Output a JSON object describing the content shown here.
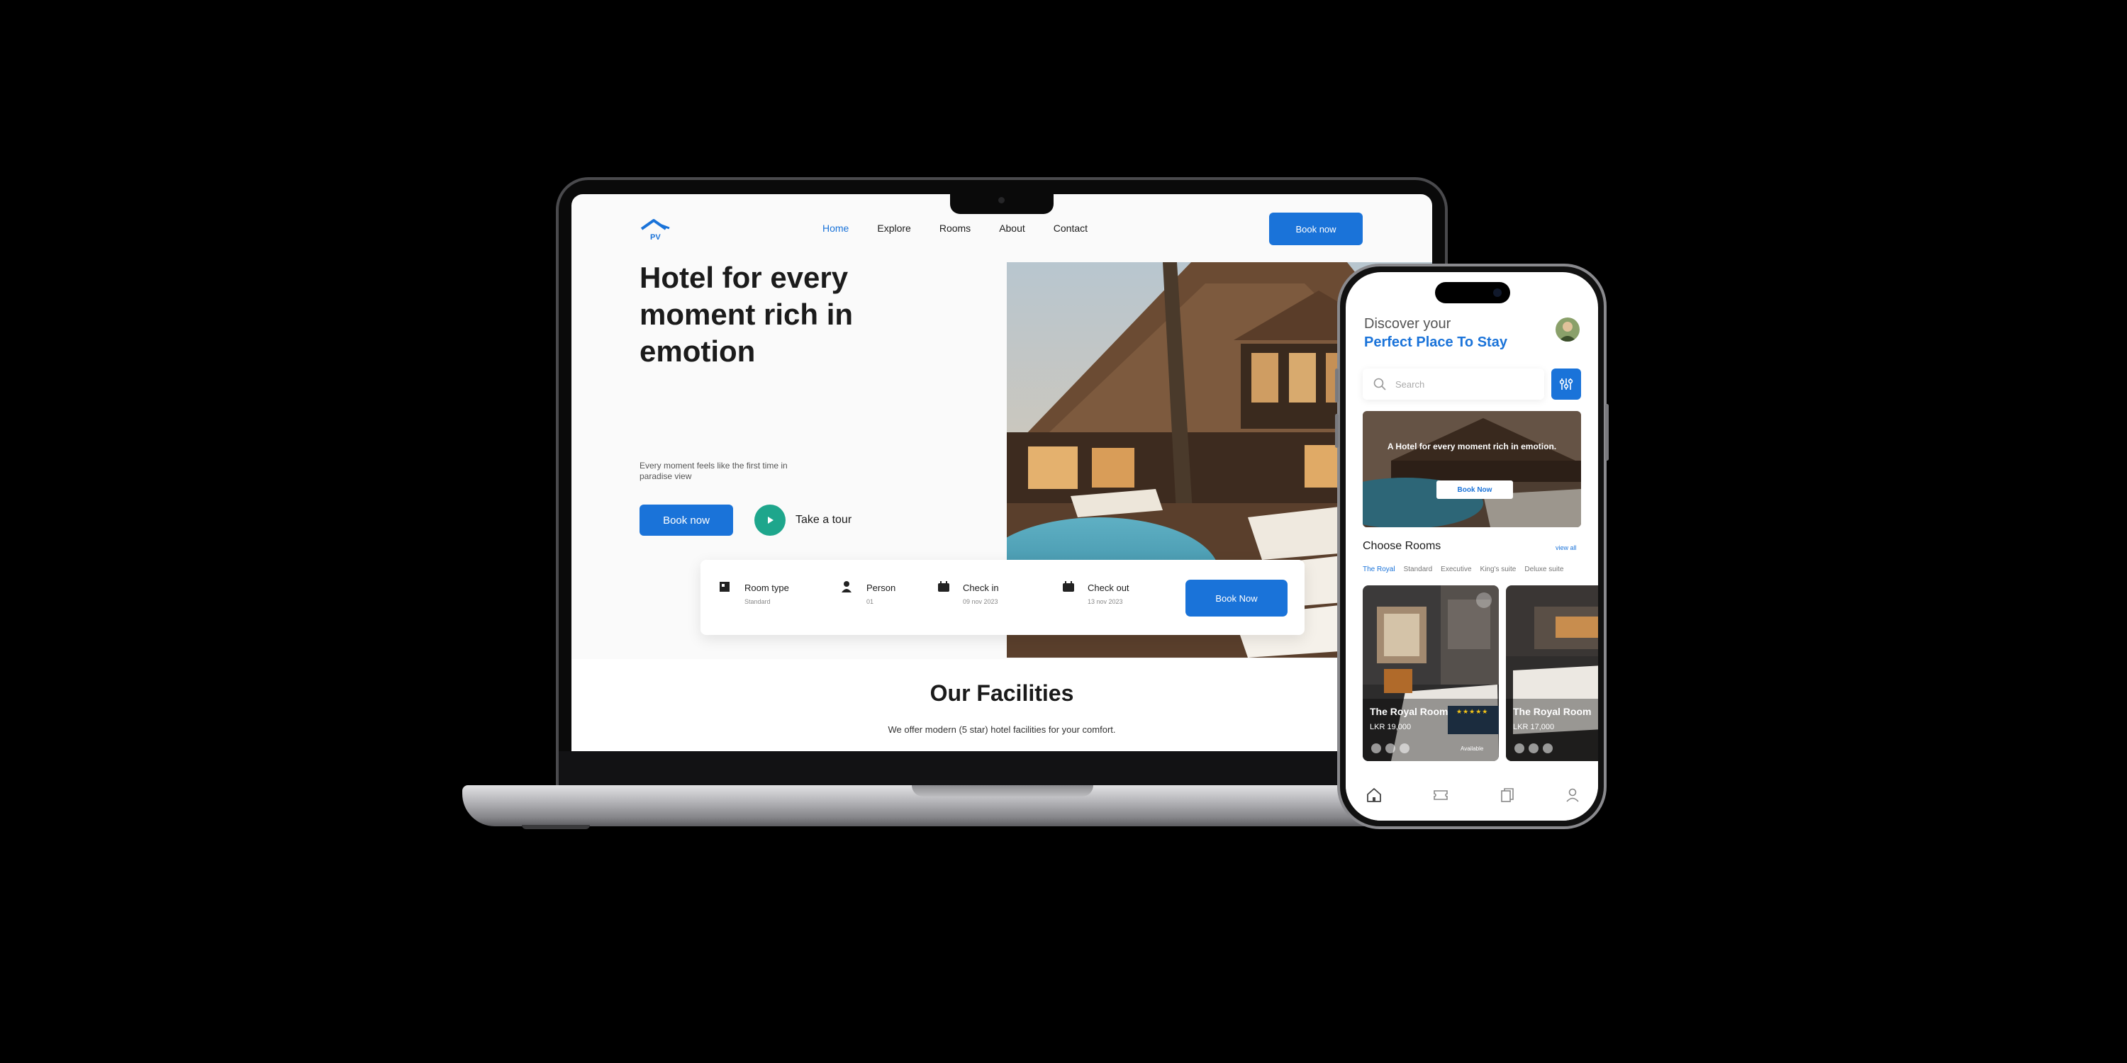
{
  "laptop": {
    "site": {
      "nav": [
        "Home",
        "Explore",
        "Rooms",
        "About",
        "Contact"
      ],
      "header_book_label": "Book now",
      "hero": {
        "title": "Hotel for every moment rich in emotion",
        "subtitle": "Every moment feels like the first time in paradise view",
        "book_label": "Book now",
        "tour_label": "Take a tour"
      },
      "booking": {
        "room_type": {
          "label": "Room type",
          "value": "Standard"
        },
        "person": {
          "label": "Person",
          "value": "01"
        },
        "check_in": {
          "label": "Check in",
          "value": "09 nov 2023"
        },
        "check_out": {
          "label": "Check out",
          "value": "13 nov 2023"
        },
        "button_label": "Book Now"
      },
      "facilities": {
        "title": "Our Facilities",
        "subtitle": "We offer modern (5 star) hotel facilities for your comfort."
      }
    }
  },
  "phone": {
    "greeting": "Discover your",
    "title": "Perfect Place To Stay",
    "search_placeholder": "Search",
    "banner": {
      "text": "A Hotel for every moment rich in emotion.",
      "button_label": "Book Now"
    },
    "section_title": "Choose Rooms",
    "view_all": "view all",
    "tabs": [
      "The Royal",
      "Standard",
      "Executive",
      "King's suite",
      "Deluxe suite"
    ],
    "rooms": [
      {
        "name": "The Royal Room",
        "price": "LKR 19,000",
        "stars": "★★★★★",
        "status": "Available"
      },
      {
        "name": "The Royal Room",
        "price": "LKR 17,000"
      }
    ],
    "tabbar_icons": [
      "home-icon",
      "ticket-icon",
      "bookmarks-icon",
      "profile-icon"
    ]
  },
  "colors": {
    "accent": "#1a73d9",
    "tour_button": "#1ea68c",
    "star": "#f5c518"
  }
}
